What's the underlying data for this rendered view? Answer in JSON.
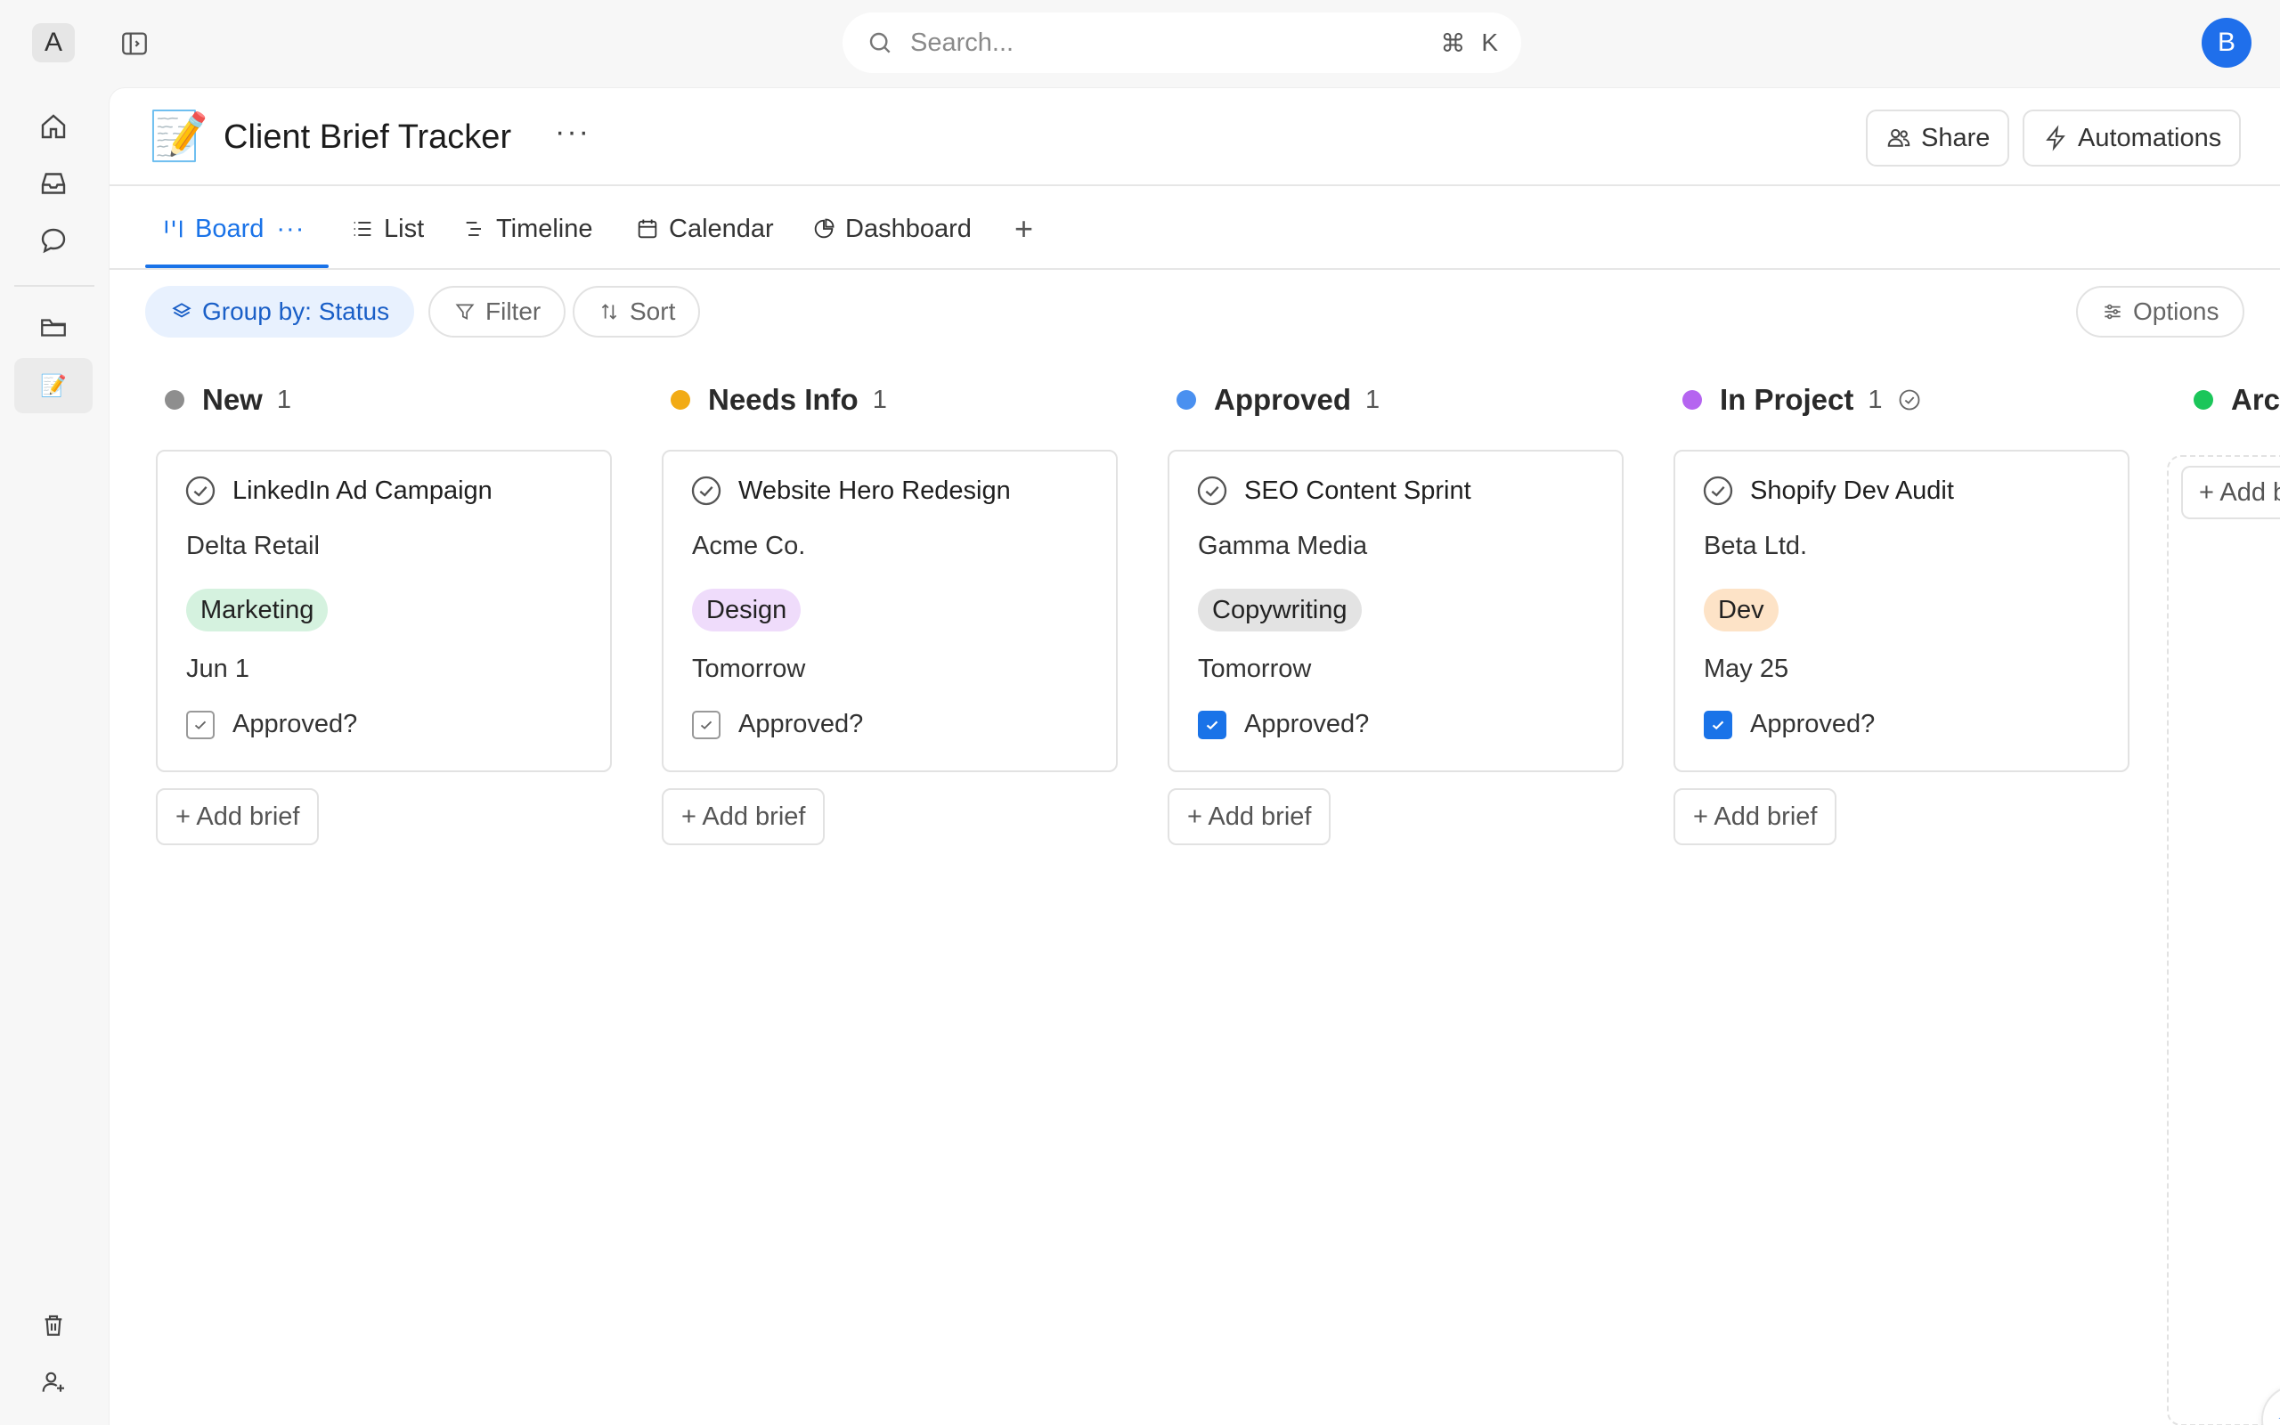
{
  "workspace": {
    "initial": "A"
  },
  "search": {
    "placeholder": "Search...",
    "shortcut_symbol": "⌘",
    "shortcut_key": "K"
  },
  "user": {
    "initial": "B"
  },
  "rail": {
    "icons": [
      "home-icon",
      "inbox-icon",
      "chat-icon",
      "folder-icon",
      "page-icon",
      "trash-icon",
      "add-user-icon"
    ],
    "active_page_emoji": "📝"
  },
  "page": {
    "emoji": "📝",
    "title": "Client Brief Tracker",
    "more": "···",
    "share_label": "Share",
    "automations_label": "Automations"
  },
  "tabs": [
    {
      "label": "Board",
      "icon": "board-icon",
      "active": true,
      "more": "···"
    },
    {
      "label": "List",
      "icon": "list-icon"
    },
    {
      "label": "Timeline",
      "icon": "timeline-icon"
    },
    {
      "label": "Calendar",
      "icon": "calendar-icon"
    },
    {
      "label": "Dashboard",
      "icon": "dashboard-icon"
    },
    {
      "label": "+",
      "icon": "plus-icon"
    }
  ],
  "toolbar": {
    "group_by": "Group by: Status",
    "filter": "Filter",
    "sort": "Sort",
    "options": "Options"
  },
  "columns": [
    {
      "name": "New",
      "count": "1",
      "color": "#8e8e8e",
      "card": {
        "title": "LinkedIn Ad Campaign",
        "client": "Delta Retail",
        "tag": "Marketing",
        "tag_color": "#d5f2df",
        "date": "Jun 1",
        "approved_label": "Approved?",
        "approved": false
      },
      "add_label": "+ Add brief"
    },
    {
      "name": "Needs Info",
      "count": "1",
      "color": "#f2ab15",
      "card": {
        "title": "Website Hero Redesign",
        "client": "Acme Co.",
        "tag": "Design",
        "tag_color": "#efdcfb",
        "date": "Tomorrow",
        "approved_label": "Approved?",
        "approved": false
      },
      "add_label": "+ Add brief"
    },
    {
      "name": "Approved",
      "count": "1",
      "color": "#4a90f0",
      "card": {
        "title": "SEO Content Sprint",
        "client": "Gamma Media",
        "tag": "Copywriting",
        "tag_color": "#e3e3e3",
        "date": "Tomorrow",
        "approved_label": "Approved?",
        "approved": true
      },
      "add_label": "+ Add brief"
    },
    {
      "name": "In Project",
      "count": "1",
      "color": "#b565f0",
      "card": {
        "title": "Shopify Dev Audit",
        "client": "Beta Ltd.",
        "tag": "Dev",
        "tag_color": "#fde3c7",
        "date": "May 25",
        "approved_label": "Approved?",
        "approved": true
      },
      "add_label": "+ Add brief"
    }
  ],
  "archived_column": {
    "name": "Arch",
    "color": "#1bc65a",
    "add_label": "+ Add b"
  }
}
